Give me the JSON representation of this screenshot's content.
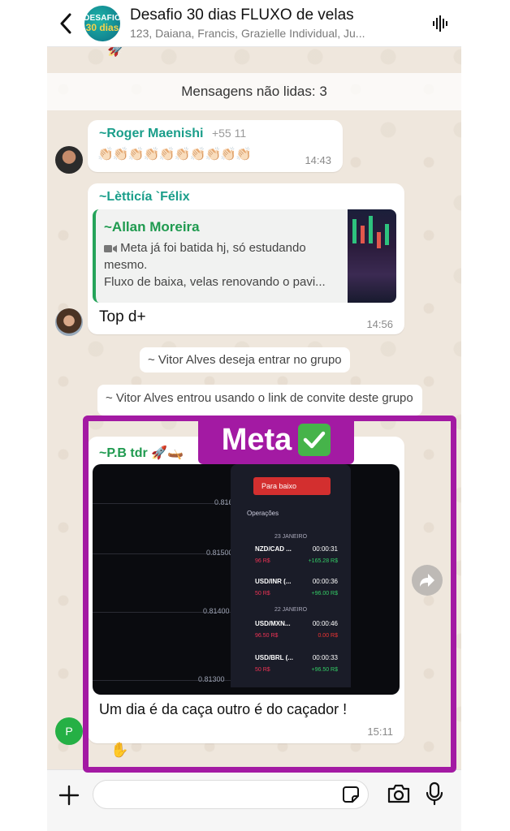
{
  "header": {
    "group_avatar_line1": "DESAFIO",
    "group_avatar_line2": "30 dias",
    "title": "Desafio 30 dias FLUXO de velas",
    "subtitle": "123, Daiana, Francis, Grazielle Individual, Ju..."
  },
  "unread": {
    "label": "Mensagens não lidas: 3"
  },
  "messages": [
    {
      "sender": "~Roger Maenishi",
      "phone": "+55 11",
      "text": "👏🏻👏🏻👏🏻👏🏻👏🏻👏🏻👏🏻👏🏻👏🏻👏🏻",
      "time": "14:43"
    },
    {
      "sender": "~Lètticía `Félix",
      "quote_sender": "~Allan Moreira",
      "quote_line1": "Meta já foi batida hj, só estudando",
      "quote_line2": "mesmo.",
      "quote_line3": "Fluxo de baixa, velas renovando o pavi...",
      "text": "Top d+",
      "time": "14:56"
    },
    {
      "sender": "~P.B tdr 🚀🛶",
      "caption": "Um dia é da caça outro é do caçador !",
      "time": "15:11",
      "avatar_letter": "P"
    }
  ],
  "system": {
    "join_request": "~ Vitor Alves deseja entrar no grupo",
    "joined": "~ Vitor Alves entrou usando o link de convite deste grupo"
  },
  "trade_app": {
    "sell_button": "Para baixo",
    "ops_header": "Operações",
    "price_levels": [
      "0.81600",
      "0.81500",
      "0.81400",
      "0.81300"
    ],
    "dates": [
      "23 JANEIRO",
      "22 JANEIRO"
    ],
    "operations": [
      {
        "pair": "NZD/CAD ...",
        "time": "00:00:31",
        "amount": "96 R$",
        "result": "+165.28 R$"
      },
      {
        "pair": "USD/INR (...",
        "time": "00:00:36",
        "amount": "50 R$",
        "result": "+96.00 R$"
      },
      {
        "pair": "USD/MXN...",
        "time": "00:00:46",
        "amount": "96.50 R$",
        "result": "0.00 R$"
      },
      {
        "pair": "USD/BRL (...",
        "time": "00:00:33",
        "amount": "50 R$",
        "result": "+96.50 R$"
      }
    ]
  },
  "annotation": {
    "label": "Meta"
  },
  "colors": {
    "accent_green": "#25a45a",
    "annotation_purple": "#a31aa3",
    "sender_teal": "#1a9e8a"
  }
}
